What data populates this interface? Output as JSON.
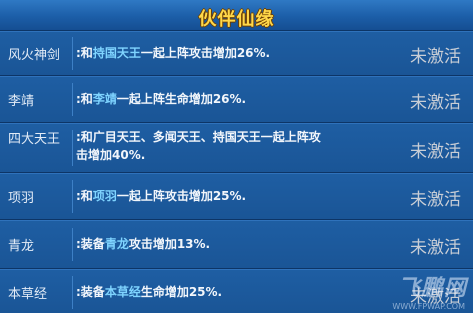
{
  "window": {
    "title": "伙伴仙缘"
  },
  "rows": [
    {
      "name": "风火神剑",
      "desc_prefix": ":和",
      "highlight": "持国天王",
      "desc_suffix": "一起上阵攻击增加26%.",
      "status": "未激活"
    },
    {
      "name": "李靖",
      "desc_prefix": ":和",
      "highlight": "李靖",
      "desc_suffix": "一起上阵生命增加26%.",
      "status": "未激活"
    },
    {
      "name": "四大天王",
      "desc_line1": ":和广目天王、多闻天王、持国天王一起上阵攻",
      "desc_line2": "击增加40%.",
      "status": "未激活"
    },
    {
      "name": "项羽",
      "desc_prefix": ":和",
      "highlight": "项羽",
      "desc_suffix": "一起上阵攻击增加25%.",
      "status": "未激活"
    },
    {
      "name": "青龙",
      "desc_prefix": ":装备",
      "highlight": "青龙",
      "desc_suffix": "攻击增加13%.",
      "status": "未激活"
    },
    {
      "name": "本草经",
      "desc_prefix": ":装备",
      "highlight": "本草经",
      "desc_suffix": "生命增加25%.",
      "status": "未激活"
    }
  ],
  "watermark": {
    "text": "飞鹏网",
    "url": "WWW.FPWAP.COM"
  }
}
